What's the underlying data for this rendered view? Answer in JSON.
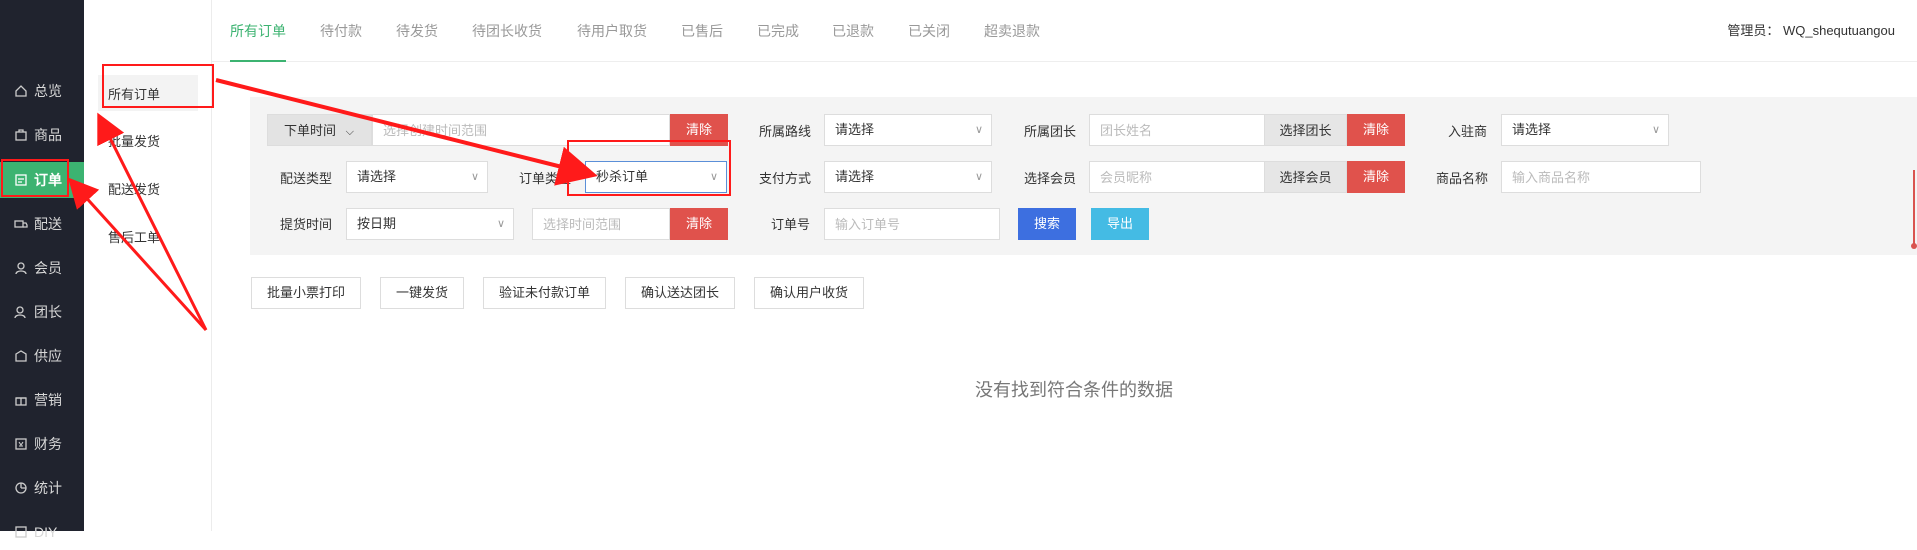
{
  "sidebar": {
    "items": [
      {
        "label": "总览",
        "icon": "home-icon"
      },
      {
        "label": "商品",
        "icon": "goods-icon"
      },
      {
        "label": "订单",
        "icon": "order-icon"
      },
      {
        "label": "配送",
        "icon": "delivery-icon"
      },
      {
        "label": "会员",
        "icon": "user-icon"
      },
      {
        "label": "团长",
        "icon": "leader-icon"
      },
      {
        "label": "供应",
        "icon": "supply-icon"
      },
      {
        "label": "营销",
        "icon": "gift-icon"
      },
      {
        "label": "财务",
        "icon": "finance-icon"
      },
      {
        "label": "统计",
        "icon": "stats-icon"
      },
      {
        "label": "DIY",
        "icon": "diy-icon"
      }
    ],
    "active_color": "#3cb371"
  },
  "subnav": {
    "items": [
      {
        "label": "所有订单"
      },
      {
        "label": "批量发货"
      },
      {
        "label": "配送发货"
      },
      {
        "label": "售后工单"
      }
    ]
  },
  "tabs": [
    {
      "label": "所有订单"
    },
    {
      "label": "待付款"
    },
    {
      "label": "待发货"
    },
    {
      "label": "待团长收货"
    },
    {
      "label": "待用户取货"
    },
    {
      "label": "已售后"
    },
    {
      "label": "已完成"
    },
    {
      "label": "已退款"
    },
    {
      "label": "已关闭"
    },
    {
      "label": "超卖退款"
    }
  ],
  "admin_label": "管理员： WQ_shequtuangou",
  "filter": {
    "time_type": "下单时间",
    "time_range_placeholder": "选择创建时间范围",
    "clear": "清除",
    "route_label": "所属路线",
    "route_value": "请选择",
    "leader_label": "所属团长",
    "leader_placeholder": "团长姓名",
    "select_leader": "选择团长",
    "merchant_label": "入驻商",
    "merchant_value": "请选择",
    "delivery_type_label": "配送类型",
    "delivery_type_value": "请选择",
    "order_type_label": "订单类型",
    "order_type_value": "秒杀订单",
    "pay_method_label": "支付方式",
    "pay_method_value": "请选择",
    "member_label": "选择会员",
    "member_placeholder": "会员昵称",
    "select_member": "选择会员",
    "product_name_label": "商品名称",
    "product_name_placeholder": "输入商品名称",
    "pickup_time_label": "提货时间",
    "pickup_time_value": "按日期",
    "pickup_range_placeholder": "选择时间范围",
    "order_no_label": "订单号",
    "order_no_placeholder": "输入订单号",
    "search": "搜索",
    "export": "导出"
  },
  "actions": [
    {
      "label": "批量小票打印"
    },
    {
      "label": "一键发货"
    },
    {
      "label": "验证未付款订单"
    },
    {
      "label": "确认送达团长"
    },
    {
      "label": "确认用户收货"
    }
  ],
  "empty_message": "没有找到符合条件的数据",
  "annotation_color": "#ff1a1a"
}
